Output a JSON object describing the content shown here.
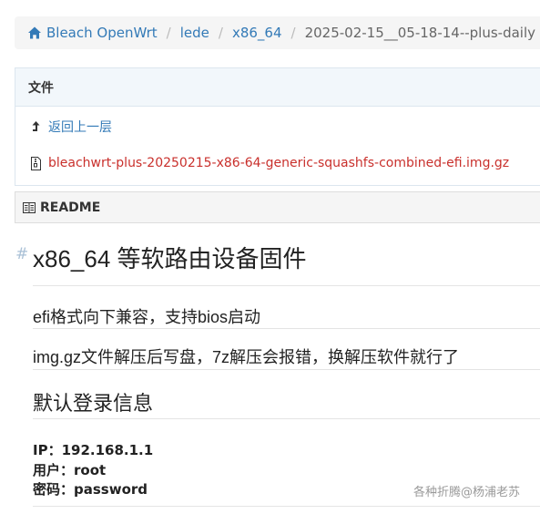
{
  "breadcrumb": {
    "items": [
      "Bleach OpenWrt",
      "lede",
      "x86_64"
    ],
    "separator": "/",
    "current": "2025-02-15__05-18-14--plus-daily"
  },
  "files": {
    "header": "文件",
    "up_label": "返回上一层",
    "file_name": "bleachwrt-plus-20250215-x86-64-generic-squashfs-combined-efi.img.gz"
  },
  "readme": {
    "header": "README",
    "anchor": "#",
    "title": "x86_64 等软路由设备固件",
    "para1": "efi格式向下兼容，支持bios启动",
    "para2": "img.gz文件解压后写盘，7z解压会报错，换解压软件就行了",
    "section_title": "默认登录信息",
    "info": [
      "IP：192.168.1.1",
      "用户：root",
      "密码：password"
    ]
  },
  "watermark": "各种折腾@杨浦老苏",
  "colors": {
    "link": "#337ab7",
    "file_link": "#c9302c",
    "panel_header_bg": "#f2f7fb"
  }
}
